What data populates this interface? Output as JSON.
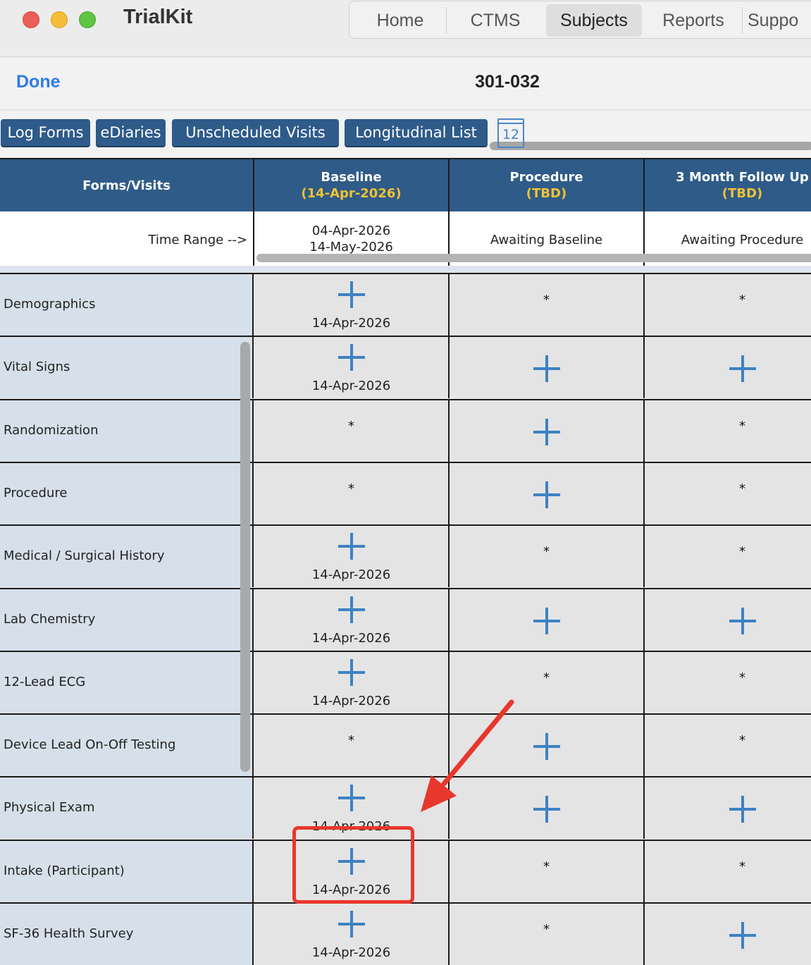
{
  "window": {
    "app_title": "TrialKit",
    "nav": [
      "Home",
      "CTMS",
      "Subjects",
      "Reports",
      "Suppo"
    ],
    "active_nav": "Subjects"
  },
  "header": {
    "done_label": "Done",
    "subject_id": "301-032"
  },
  "toolbar": {
    "buttons": [
      "Log Forms",
      "eDiaries",
      "Unscheduled Visits",
      "Longitudinal List"
    ],
    "calendar_day": "12"
  },
  "grid": {
    "forms_header": "Forms/Visits",
    "visits": [
      {
        "name": "Baseline",
        "date": "(14-Apr-2026)"
      },
      {
        "name": "Procedure",
        "date": "(TBD)"
      },
      {
        "name": "3 Month Follow Up",
        "date": "(TBD)"
      }
    ],
    "time_range_label": "Time Range -->",
    "time_range": [
      {
        "start": "04-Apr-2026",
        "end": "14-May-2026"
      },
      {
        "text": "Awaiting Baseline"
      },
      {
        "text": "Awaiting Procedure"
      }
    ],
    "not_scheduled_mark": "*",
    "forms": [
      {
        "label": "Demographics",
        "cells": [
          {
            "t": "plus",
            "date": "14-Apr-2026"
          },
          {
            "t": "dot"
          },
          {
            "t": "dot"
          }
        ]
      },
      {
        "label": "Vital Signs",
        "cells": [
          {
            "t": "plus",
            "date": "14-Apr-2026"
          },
          {
            "t": "plus"
          },
          {
            "t": "plus"
          }
        ]
      },
      {
        "label": "Randomization",
        "cells": [
          {
            "t": "dot"
          },
          {
            "t": "plus"
          },
          {
            "t": "dot"
          }
        ]
      },
      {
        "label": "Procedure",
        "cells": [
          {
            "t": "dot"
          },
          {
            "t": "plus"
          },
          {
            "t": "dot"
          }
        ]
      },
      {
        "label": "Medical / Surgical History",
        "cells": [
          {
            "t": "plus",
            "date": "14-Apr-2026"
          },
          {
            "t": "dot"
          },
          {
            "t": "dot"
          }
        ]
      },
      {
        "label": "Lab Chemistry",
        "cells": [
          {
            "t": "plus",
            "date": "14-Apr-2026"
          },
          {
            "t": "plus"
          },
          {
            "t": "plus"
          }
        ]
      },
      {
        "label": "12-Lead ECG",
        "cells": [
          {
            "t": "plus",
            "date": "14-Apr-2026"
          },
          {
            "t": "dot"
          },
          {
            "t": "dot"
          }
        ]
      },
      {
        "label": "Device Lead On-Off Testing",
        "cells": [
          {
            "t": "dot"
          },
          {
            "t": "plus"
          },
          {
            "t": "dot"
          }
        ]
      },
      {
        "label": "Physical Exam",
        "cells": [
          {
            "t": "plus",
            "date": "14-Apr-2026"
          },
          {
            "t": "plus"
          },
          {
            "t": "plus"
          }
        ]
      },
      {
        "label": "Intake (Participant)",
        "cells": [
          {
            "t": "plus",
            "date": "14-Apr-2026"
          },
          {
            "t": "dot"
          },
          {
            "t": "dot"
          }
        ]
      },
      {
        "label": "SF-36 Health Survey",
        "cells": [
          {
            "t": "plus",
            "date": "14-Apr-2026"
          },
          {
            "t": "dot"
          },
          {
            "t": "plus"
          }
        ]
      }
    ]
  },
  "colors": {
    "header_blue": "#2f5b88",
    "date_gold": "#f1c232",
    "plus_blue": "#3d82c4",
    "annotation_red": "#e8372c"
  }
}
